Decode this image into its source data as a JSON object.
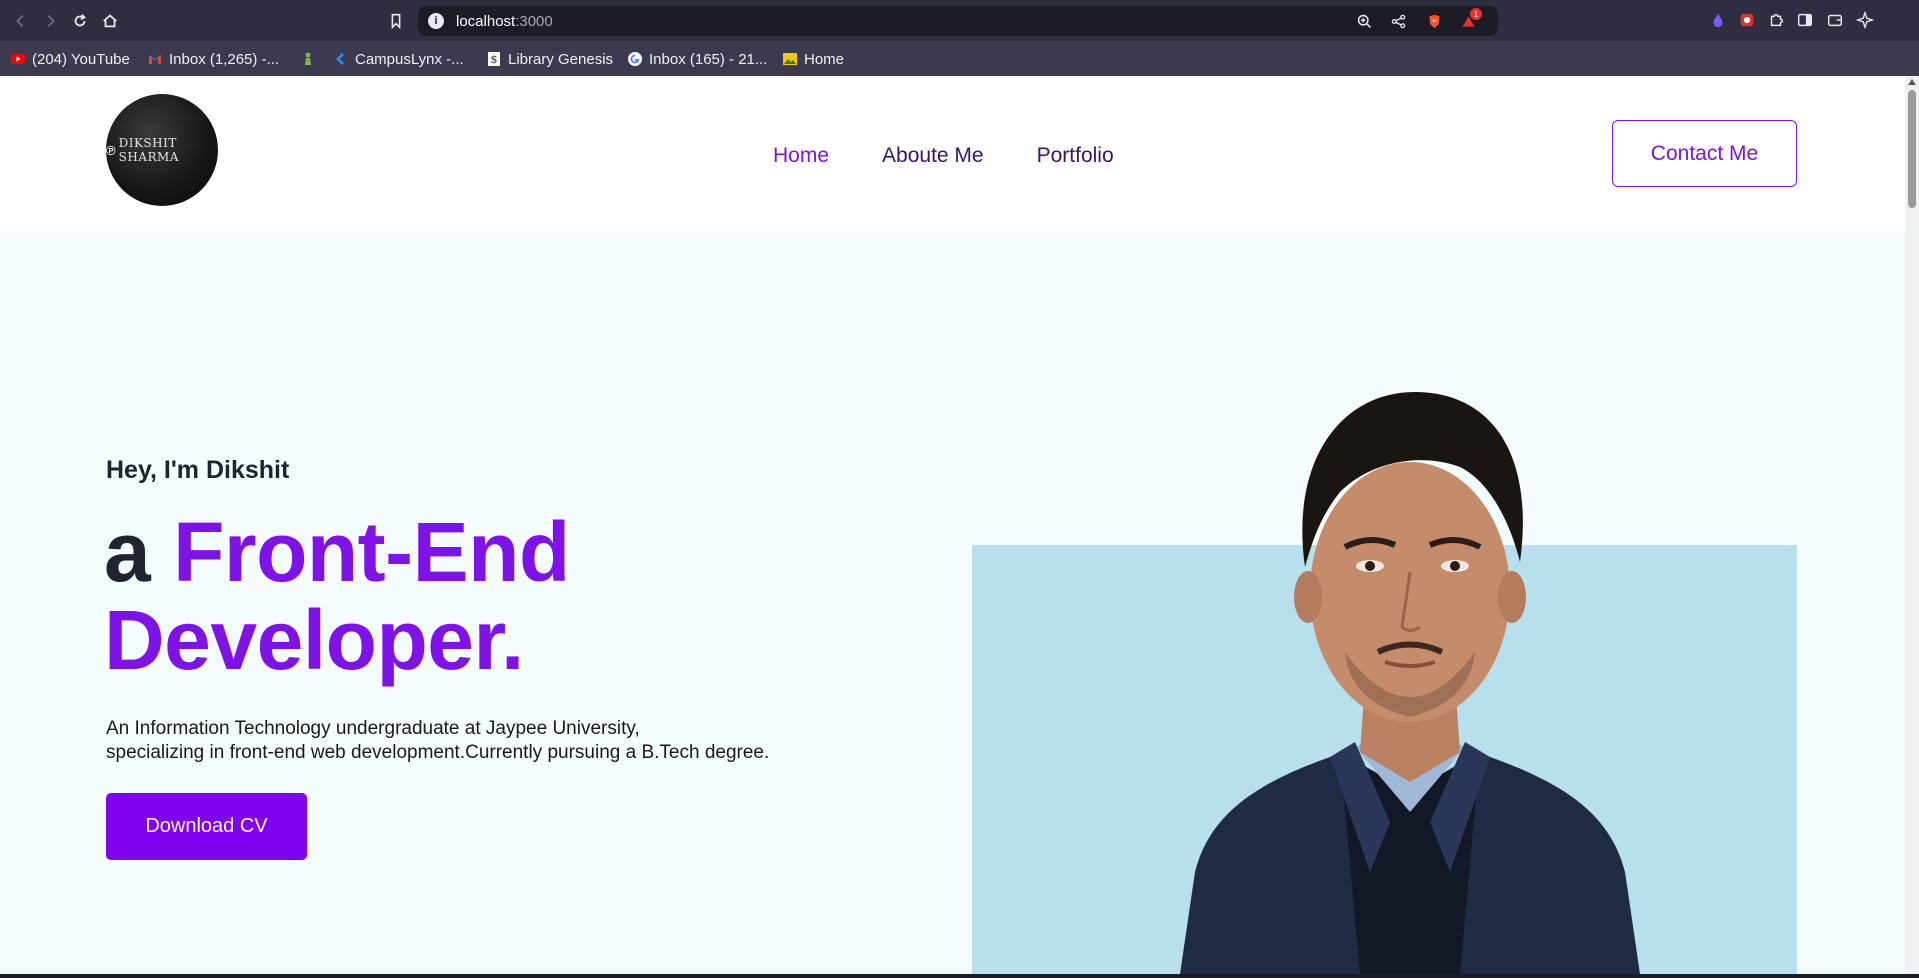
{
  "browser": {
    "url_host": "localhost",
    "url_port": ":3000",
    "notification_count": "1",
    "bookmarks": [
      {
        "label": "(204) YouTube",
        "icon": "youtube-icon"
      },
      {
        "label": "Inbox (1,265) -...",
        "icon": "gmail-icon"
      },
      {
        "label": "",
        "icon": "chess-pawn-icon"
      },
      {
        "label": "CampusLynx -...",
        "icon": "campuslynx-icon"
      },
      {
        "label": "Library Genesis",
        "icon": "library-genesis-icon"
      },
      {
        "label": "Inbox (165) - 21...",
        "icon": "google-icon"
      },
      {
        "label": "Home",
        "icon": "photos-icon"
      }
    ]
  },
  "site": {
    "logo_text": "DIKSHIT SHARMA",
    "nav": [
      {
        "label": "Home",
        "active": true
      },
      {
        "label": "Aboute Me",
        "active": false
      },
      {
        "label": "Portfolio",
        "active": false
      }
    ],
    "contact_label": "Contact Me"
  },
  "hero": {
    "greeting": "Hey, I'm Dikshit",
    "headline_prefix": "a",
    "headline_accent_1": "Front-End",
    "headline_accent_2": "Developer.",
    "intro_line_1": "An Information Technology undergraduate at Jaypee University,",
    "intro_line_2": "specializing in front-end web development.Currently pursuing a B.Tech degree.",
    "cv_button": "Download CV"
  },
  "colors": {
    "accent": "#7f12e8",
    "button": "#7f02f0",
    "nav_text": "#3b1467",
    "hero_bg": "#f4fcfe",
    "photo_bg": "#b7e0ec"
  }
}
